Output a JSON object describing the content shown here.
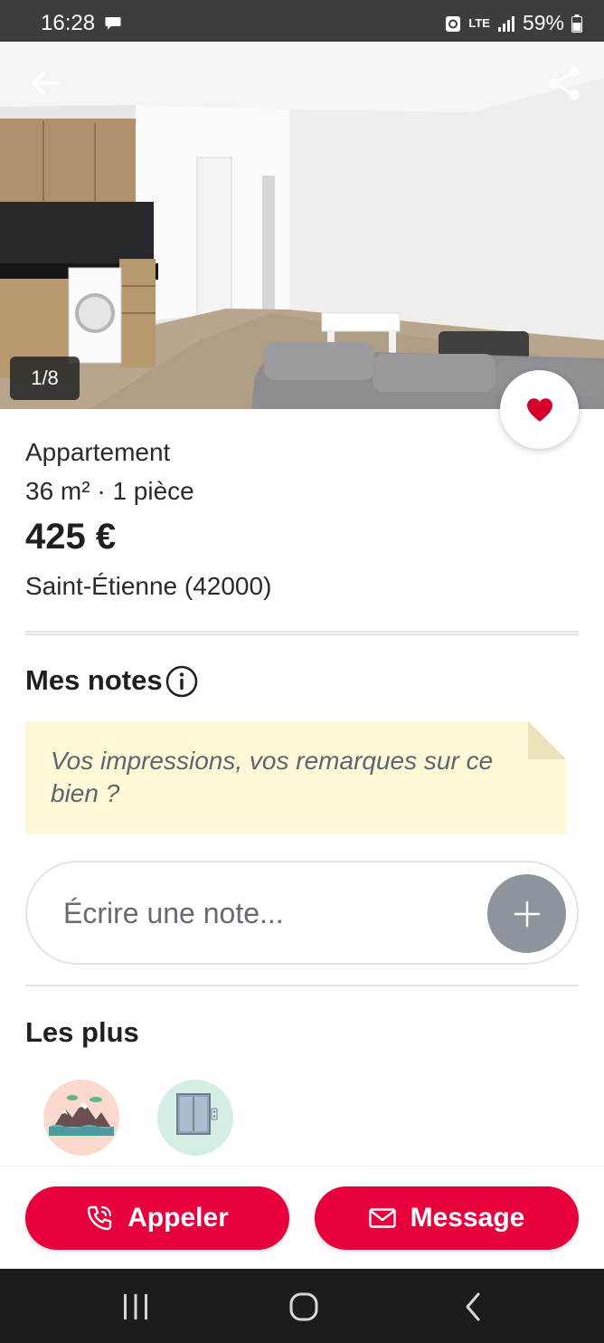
{
  "status_bar": {
    "time": "16:28",
    "network": "LTE",
    "battery": "59%"
  },
  "hero": {
    "photo_counter": "1/8",
    "current_photo": 1,
    "total_photos": 8
  },
  "listing": {
    "type": "Appartement",
    "size_rooms": "36 m² · 1 pièce",
    "price": "425 €",
    "location": "Saint-Étienne (42000)",
    "favorited": true
  },
  "notes": {
    "title": "Mes notes",
    "sticky_text": "Vos impressions, vos remarques sur ce bien ?",
    "input_placeholder": "Écrire une note..."
  },
  "features": {
    "title": "Les plus",
    "items": [
      {
        "icon": "mountain-view-icon"
      },
      {
        "icon": "elevator-icon"
      }
    ]
  },
  "actions": {
    "call_label": "Appeler",
    "message_label": "Message"
  },
  "colors": {
    "accent": "#e8003d",
    "status_bar": "#3d3d3d",
    "sticky_note": "#fdf9d6",
    "add_button": "#8e949b"
  }
}
